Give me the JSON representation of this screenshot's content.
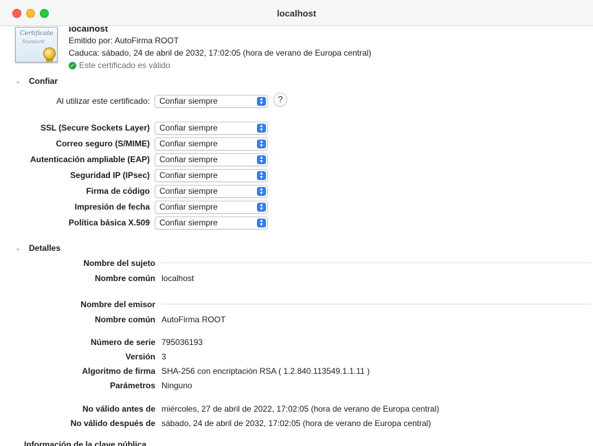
{
  "window": {
    "title": "localhost"
  },
  "certificate": {
    "name": "localhost",
    "icon_text_1": "Certificate",
    "icon_text_2": "Standard",
    "issued_by": "Emitido por: AutoFirma ROOT",
    "expires": "Caduca: sábado, 24 de abril de 2032, 17:02:05 (hora de verano de Europa central)",
    "valid_text": "Este certificado es válido"
  },
  "trust": {
    "heading": "Confiar",
    "when_using_label": "Al utilizar este certificado:",
    "when_using_value": "Confiar siempre",
    "help_label": "?",
    "rows": [
      {
        "label": "SSL (Secure Sockets Layer)",
        "value": "Confiar siempre"
      },
      {
        "label": "Correo seguro (S/MIME)",
        "value": "Confiar siempre"
      },
      {
        "label": "Autenticación ampliable (EAP)",
        "value": "Confiar siempre"
      },
      {
        "label": "Seguridad IP (IPsec)",
        "value": "Confiar siempre"
      },
      {
        "label": "Firma de código",
        "value": "Confiar siempre"
      },
      {
        "label": "Impresión de fecha",
        "value": "Confiar siempre"
      },
      {
        "label": "Política básica X.509",
        "value": "Confiar siempre"
      }
    ]
  },
  "details": {
    "heading": "Detalles",
    "subject_heading": "Nombre del sujeto",
    "subject_cn_label": "Nombre común",
    "subject_cn_value": "localhost",
    "issuer_heading": "Nombre del emisor",
    "issuer_cn_label": "Nombre común",
    "issuer_cn_value": "AutoFirma ROOT",
    "serial_label": "Número de serie",
    "serial_value": "795036193",
    "version_label": "Versión",
    "version_value": "3",
    "sig_alg_label": "Algoritmo de firma",
    "sig_alg_value": "SHA-256 con encriptación RSA ( 1.2.840.113549.1.1.11 )",
    "params_label": "Parámetros",
    "params_value": "Ninguno",
    "not_before_label": "No válido antes de",
    "not_before_value": "miércoles, 27 de abril de 2022, 17:02:05 (hora de verano de Europa central)",
    "not_after_label": "No válido después de",
    "not_after_value": "sábado, 24 de abril de 2032, 17:02:05 (hora de verano de Europa central)",
    "next_section_cut": "Información de la clave pública"
  },
  "colors": {
    "accent": "#2f7cf6",
    "valid_green": "#29a745",
    "close": "#fe5f57",
    "minimize": "#febc2e",
    "maximize": "#28c840"
  }
}
